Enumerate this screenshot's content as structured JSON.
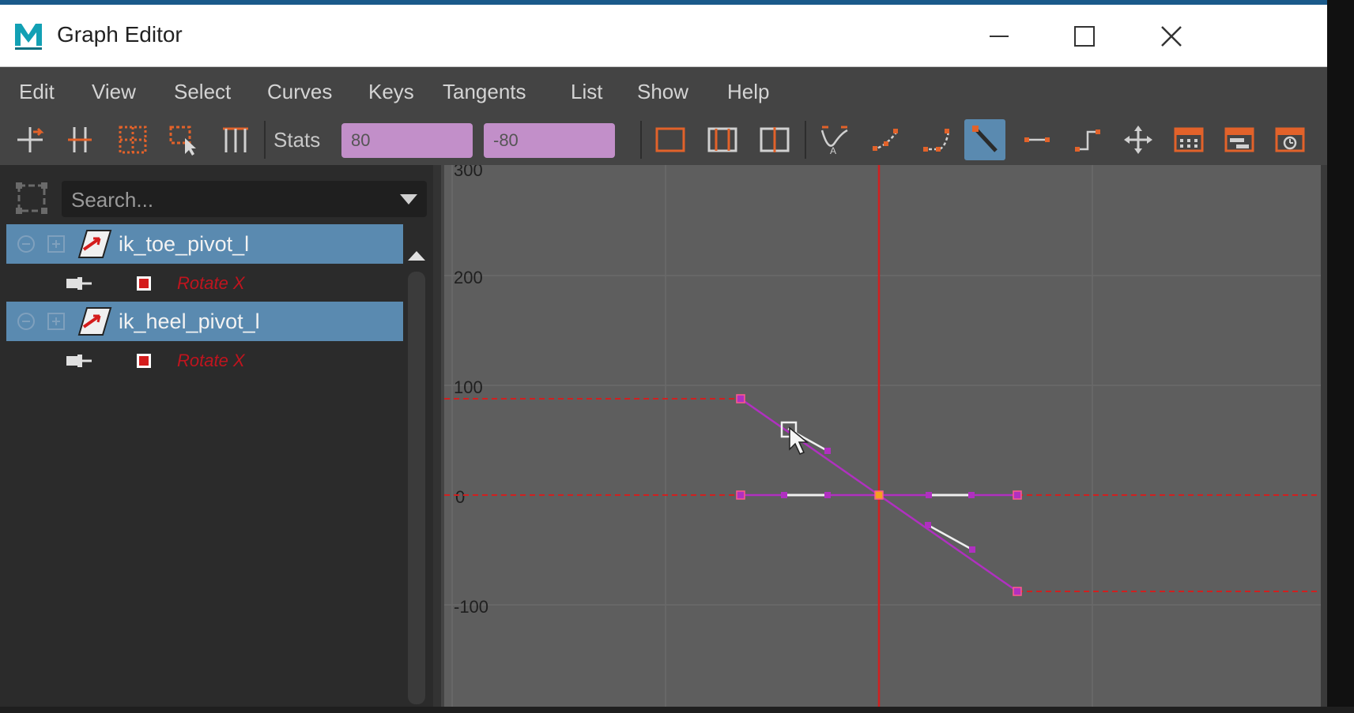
{
  "window": {
    "title": "Graph Editor",
    "app_icon": "maya-logo-icon",
    "controls": [
      "minimize-icon",
      "maximize-icon",
      "close-icon"
    ]
  },
  "menu": {
    "items": [
      "Edit",
      "View",
      "Select",
      "Curves",
      "Keys",
      "Tangents",
      "List",
      "Show",
      "Help"
    ]
  },
  "toolbar": {
    "stats_label": "Stats",
    "stat_value_1": "80",
    "stat_value_2": "-80",
    "stat_field_color": "#c28fc9",
    "active_tool": "tangent-edit-icon"
  },
  "outliner": {
    "search_placeholder": "Search...",
    "items": [
      {
        "name": "ik_toe_pivot_l",
        "attribute": "Rotate X",
        "selected": true
      },
      {
        "name": "ik_heel_pivot_l",
        "attribute": "Rotate X",
        "selected": true
      }
    ]
  },
  "graph": {
    "y_labels": [
      "300",
      "200",
      "100",
      "0",
      "-100"
    ],
    "curve_color": "#b030c0",
    "current_time_color": "#d02020",
    "curves": [
      {
        "name": "ik_toe_pivot_l Rotate X",
        "keys": [
          [
            -8,
            80
          ],
          [
            8,
            -80
          ]
        ]
      },
      {
        "name": "ik_heel_pivot_l Rotate X",
        "keys": [
          [
            -8,
            0
          ],
          [
            0,
            0
          ],
          [
            8,
            0
          ]
        ]
      }
    ]
  }
}
